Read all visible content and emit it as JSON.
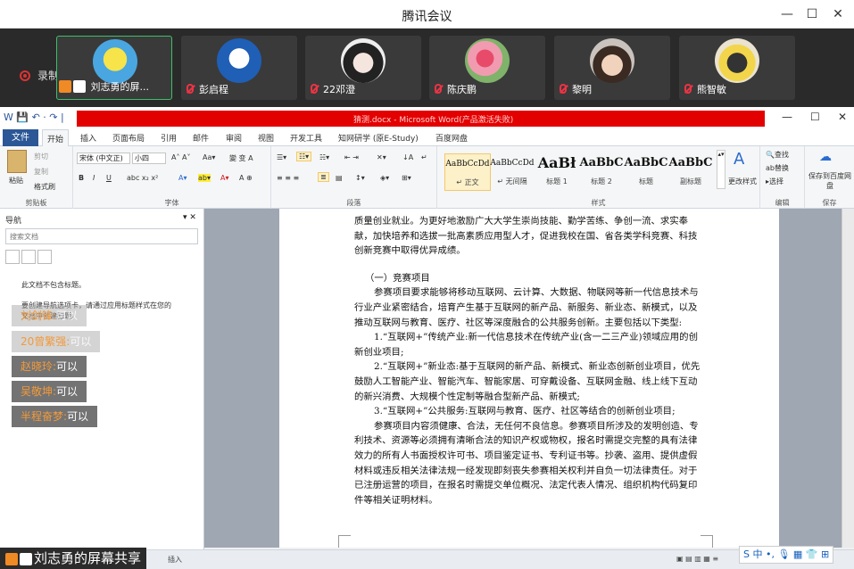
{
  "meeting": {
    "title": "腾讯会议",
    "recording_label": "录制中",
    "participants": [
      {
        "name": "刘志勇的屏...",
        "avatar": "spongebob-avatar",
        "muted": false
      },
      {
        "name": "彭启程",
        "avatar": "donald-duck-avatar",
        "muted": true
      },
      {
        "name": "22邓澄",
        "avatar": "anime-girl-avatar",
        "muted": true
      },
      {
        "name": "陈庆鹏",
        "avatar": "flowers-avatar",
        "muted": true
      },
      {
        "name": "黎明",
        "avatar": "anime-boy-avatar",
        "muted": true
      },
      {
        "name": "熊智敏",
        "avatar": "cartoon-character-avatar",
        "muted": true
      }
    ],
    "sharer_label": "刘志勇的屏幕共享"
  },
  "word": {
    "qat": "W  💾  ↶ · ↷  |",
    "title": "猜测.docx - Microsoft Word(产品激活失败)",
    "tabs": [
      "文件",
      "开始",
      "插入",
      "页面布局",
      "引用",
      "邮件",
      "审阅",
      "视图",
      "开发工具",
      "知网研学 (原E-Study)",
      "百度网盘"
    ],
    "ribbon": {
      "clipboard": {
        "paste": "粘贴",
        "cut": "剪切",
        "copy": "复制",
        "format_painter": "格式刷",
        "label": "剪贴板"
      },
      "font": {
        "font_name": "宋体 (中文正)",
        "font_size": "小四",
        "label": "字体"
      },
      "paragraph": {
        "label": "段落"
      },
      "styles": {
        "label": "样式",
        "items": [
          {
            "sample": "AaBbCcDd",
            "name": "↵ 正文"
          },
          {
            "sample": "AaBbCcDd",
            "name": "↵ 无间隔"
          },
          {
            "sample": "AaBł",
            "name": "标题 1"
          },
          {
            "sample": "AaBbC",
            "name": "标题 2"
          },
          {
            "sample": "AaBbC",
            "name": "标题"
          },
          {
            "sample": "AaBbC",
            "name": "副标题"
          }
        ],
        "change_styles": "更改样式"
      },
      "editing": {
        "find": "查找",
        "replace": "替换",
        "select": "选择",
        "label": "编辑"
      },
      "save": {
        "save_baidu": "保存到百度网盘",
        "label": "保存"
      }
    },
    "nav": {
      "title": "导航",
      "search_placeholder": "搜索文档",
      "msg1": "此文档不包含标题。",
      "msg2": "要创建导航选项卡，请通过应用标题样式在您的",
      "msg3": "文档中创建标题。"
    },
    "chat": [
      {
        "who": "刘剑锋:",
        "text": "可以",
        "faint": true
      },
      {
        "who": "20曾繁强:",
        "text": "可以",
        "faint": true
      },
      {
        "who": "赵晓玲:",
        "text": "可以",
        "faint": false
      },
      {
        "who": "吴敬坤:",
        "text": "可以",
        "faint": false
      },
      {
        "who": "半程奋梦:",
        "text": "可以",
        "faint": false
      }
    ],
    "document": {
      "para0": "质量创业就业。为更好地激励广大大学生崇尚技能、勤学苦练、争创一流、求实奉献，加快培养和选拔一批高素质应用型人才，促进我校在国、省各类学科竞赛、科技创新竞赛中取得优异成绩。",
      "heading": "（一）竞赛项目",
      "para1": "参赛项目要求能够将移动互联网、云计算、大数据、物联网等新一代信息技术与行业产业紧密结合，培育产生基于互联网的新产品、新服务、新业态、新模式，以及推动互联网与教育、医疗、社区等深度融合的公共服务创新。主要包括以下类型:",
      "item1": "1.“互联网+”传统产业:新一代信息技术在传统产业(含一二三产业)领域应用的创新创业项目;",
      "item2": "2.“互联网+”新业态:基于互联网的新产品、新模式、新业态创新创业项目，优先鼓励人工智能产业、智能汽车、智能家居、可穿戴设备、互联网金融、线上线下互动的新兴消费、大规模个性定制等融合型新产品、新模式;",
      "item3": "3.“互联网+”公共服务:互联网与教育、医疗、社区等结合的创新创业项目;",
      "para2": "参赛项目内容须健康、合法，无任何不良信息。参赛项目所涉及的发明创造、专利技术、资源等必须拥有清晰合法的知识产权或物权，报名时需提交完整的具有法律效力的所有人书面授权许可书、项目鉴定证书、专利证书等。抄袭、盗用、提供虚假材料或违反相关法律法规一经发现即刻丧失参赛相关权利并自负一切法律责任。对于已注册运营的项目，在报名时需提交单位概况、法定代表人情况、组织机构代码复印件等相关证明材料。"
    },
    "status": {
      "insert": "插入"
    }
  },
  "ime": {
    "text": "S 中 •, 🎙 ▦ 👕 ⊞"
  }
}
